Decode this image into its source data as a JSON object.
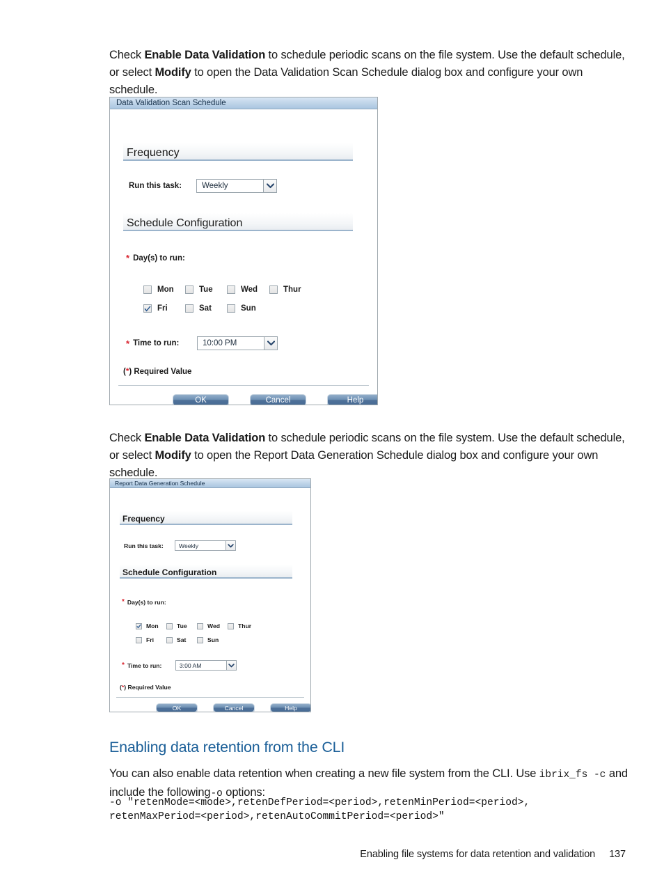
{
  "page": {
    "paragraph_1": {
      "lead": "Check ",
      "bold_1": "Enable Data Validation",
      "mid_1": " to schedule periodic scans on the file system. Use the default schedule, or select ",
      "bold_2": "Modify",
      "tail": " to open the Data Validation Scan Schedule dialog box and configure your own schedule."
    },
    "paragraph_2": {
      "lead": "Check ",
      "bold_1": "Enable Data Validation",
      "mid_1": " to schedule periodic scans on the file system. Use the default schedule, or select ",
      "bold_2": "Modify",
      "tail": " to open the Report Data Generation Schedule dialog box and configure your own schedule."
    },
    "section_heading": "Enabling data retention from the CLI",
    "paragraph_3": {
      "lead": "You can also enable data retention when creating a new file system from the CLI. Use ",
      "code_1": "ibrix_fs -c",
      "mid_1": " and include the following",
      "code_2": "-o",
      "tail": " options:"
    },
    "code_block": "-o \"retenMode=<mode>,retenDefPeriod=<period>,retenMinPeriod=<period>,\nretenMaxPeriod=<period>,retenAutoCommitPeriod=<period>\"",
    "footer": {
      "text": "Enabling file systems for data retention and validation",
      "page_number": "137"
    }
  },
  "dialog_validation": {
    "title": "Data Validation Scan Schedule",
    "frequency_heading": "Frequency",
    "run_task_label": "Run this task:",
    "run_task_value": "Weekly",
    "schedule_heading": "Schedule Configuration",
    "days_label": "Day(s) to run:",
    "required_star": "*",
    "days": [
      {
        "label": "Mon",
        "checked": false
      },
      {
        "label": "Tue",
        "checked": false
      },
      {
        "label": "Wed",
        "checked": false
      },
      {
        "label": "Thur",
        "checked": false
      },
      {
        "label": "Fri",
        "checked": true
      },
      {
        "label": "Sat",
        "checked": false
      },
      {
        "label": "Sun",
        "checked": false
      }
    ],
    "time_label": "Time to run:",
    "time_value": "10:00 PM",
    "required_note_star": "*",
    "required_note_pre": "(",
    "required_note_post": ") Required Value",
    "buttons": {
      "ok": "OK",
      "cancel": "Cancel",
      "help": "Help"
    }
  },
  "dialog_report": {
    "title": "Report Data Generation Schedule",
    "frequency_heading": "Frequency",
    "run_task_label": "Run this task:",
    "run_task_value": "Weekly",
    "schedule_heading": "Schedule Configuration",
    "days_label": "Day(s) to run:",
    "required_star": "*",
    "days": [
      {
        "label": "Mon",
        "checked": true
      },
      {
        "label": "Tue",
        "checked": false
      },
      {
        "label": "Wed",
        "checked": false
      },
      {
        "label": "Thur",
        "checked": false
      },
      {
        "label": "Fri",
        "checked": false
      },
      {
        "label": "Sat",
        "checked": false
      },
      {
        "label": "Sun",
        "checked": false
      }
    ],
    "time_label": "Time to run:",
    "time_value": "3:00 AM",
    "required_note_star": "*",
    "required_note_pre": "(",
    "required_note_post": ") Required Value",
    "buttons": {
      "ok": "OK",
      "cancel": "Cancel",
      "help": "Help"
    }
  },
  "colors": {
    "heading_blue": "#1b5f98",
    "titlebar_blue": "#c2d6ea",
    "button_blue": "#4f7199",
    "required_red": "#d9232e"
  }
}
